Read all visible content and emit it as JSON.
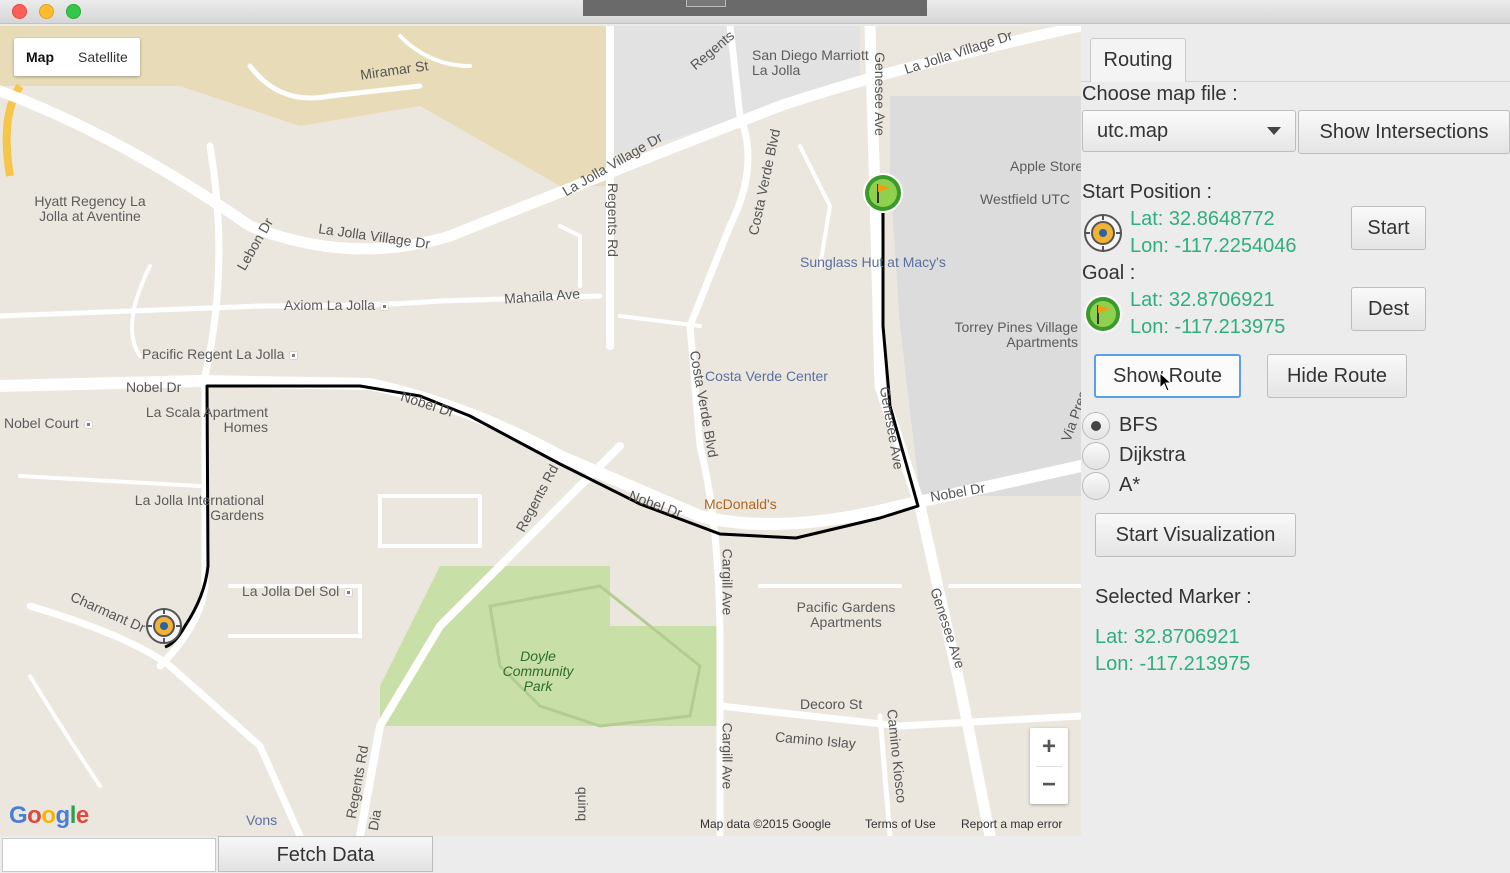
{
  "window": {
    "title_visible": false
  },
  "map": {
    "type_control": {
      "map_label": "Map",
      "satellite_label": "Satellite"
    },
    "street_labels": {
      "miramar": "Miramar St",
      "regents_top": "Regents",
      "lajolla_village_top": "La Jolla Village Dr",
      "lajolla_village_mid": "La Jolla Village Dr",
      "lajolla_village_left": "La Jolla Village Dr",
      "genesee_top": "Genesee Ave",
      "genesee_mid": "Genesee Ave",
      "genesee_bottom": "Genesee Ave",
      "regents_rd": "Regents Rd",
      "regents_rd_low": "Regents Rd",
      "regents_rd_bottom": "Regents Rd",
      "costa_verde_top": "Costa Verde Blvd",
      "costa_verde_mid": "Costa Verde Blvd",
      "lebon": "Lebon Dr",
      "mahaila": "Mahaila Ave",
      "nobel_left": "Nobel Dr",
      "nobel_mid": "Nobel Dr",
      "nobel_low": "Nobel Dr",
      "nobel_right": "Nobel Dr",
      "cargill_mid": "Cargill Ave",
      "cargill_bottom": "Cargill Ave",
      "decoro": "Decoro St",
      "camino_islay": "Camino Islay",
      "camino_kiosco": "Camino Kiosco",
      "charmant": "Charmant Dr",
      "via_pres": "Via Pres",
      "dia": "Dia",
      "quinq": "quinq"
    },
    "places": {
      "marriott": "San Diego Marriott La Jolla",
      "hyatt": "Hyatt Regency La Jolla at Aventine",
      "apple": "Apple Store",
      "westfield": "Westfield UTC",
      "sunglass": "Sunglass Hut at Macy's",
      "axiom": "Axiom La Jolla",
      "pacific_regent": "Pacific Regent La Jolla",
      "torrey_pines": "Torrey Pines Village Apartments",
      "nobel_court": "Nobel Court",
      "la_scala": "La Scala Apartment Homes",
      "costa_verde_center": "Costa Verde Center",
      "la_jolla_intl": "La Jolla International Gardens",
      "mcdonalds": "McDonald's",
      "la_jolla_del_sol": "La Jolla Del Sol",
      "pacific_gardens": "Pacific Gardens Apartments",
      "doyle": "Doyle Community Park",
      "vons": "Vons"
    },
    "attribution": {
      "data": "Map data ©2015 Google",
      "terms": "Terms of Use",
      "report": "Report a map error"
    },
    "logo": "Google",
    "zoom_in": "+",
    "zoom_out": "−"
  },
  "panel": {
    "tab_label": "Routing",
    "choose_file_label": "Choose map file :",
    "map_file_value": "utc.map",
    "show_intersections_label": "Show Intersections",
    "start_position_label": "Start Position :",
    "start_lat": "Lat: 32.8648772",
    "start_lon": "Lon: -117.2254046",
    "start_button": "Start",
    "goal_label": "Goal :",
    "goal_lat": "Lat: 32.8706921",
    "goal_lon": "Lon: -117.213975",
    "dest_button": "Dest",
    "show_route_button": "Show Route",
    "hide_route_button": "Hide Route",
    "algorithms": [
      {
        "label": "BFS",
        "selected": true
      },
      {
        "label": "Dijkstra",
        "selected": false
      },
      {
        "label": "A*",
        "selected": false
      }
    ],
    "start_visualization_button": "Start Visualization",
    "selected_marker_label": "Selected Marker :",
    "selected_lat": "Lat: 32.8706921",
    "selected_lon": "Lon: -117.213975"
  },
  "bottom": {
    "fetch_button": "Fetch Data",
    "input_value": ""
  },
  "colors": {
    "coord_text": "#2fae7e",
    "route_line": "#000000",
    "park": "#c8dfa8",
    "focus_border": "#5aa0e6"
  }
}
